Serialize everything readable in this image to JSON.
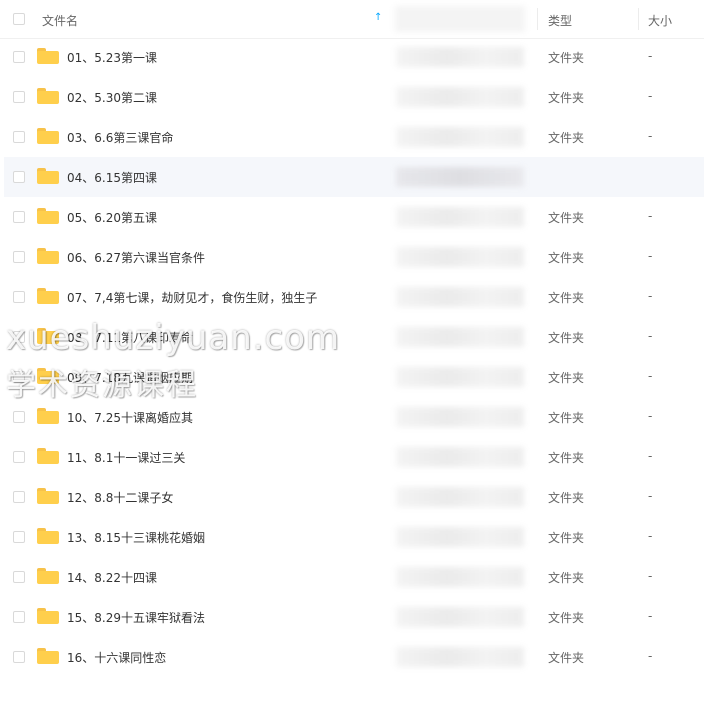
{
  "header": {
    "name_label": "文件名",
    "sort_indicator": "↑",
    "type_label": "类型",
    "size_label": "大小"
  },
  "rows": [
    {
      "name": "01、5.23第一课",
      "type": "文件夹",
      "size": "-"
    },
    {
      "name": "02、5.30第二课",
      "type": "文件夹",
      "size": "-"
    },
    {
      "name": "03、6.6第三课官命",
      "type": "文件夹",
      "size": "-"
    },
    {
      "name": "04、6.15第四课",
      "type": "",
      "size": ""
    },
    {
      "name": "05、6.20第五课",
      "type": "文件夹",
      "size": "-"
    },
    {
      "name": "06、6.27第六课当官条件",
      "type": "文件夹",
      "size": "-"
    },
    {
      "name": "07、7,4第七课，劫财见才，食伤生财，独生子",
      "type": "文件夹",
      "size": "-"
    },
    {
      "name": "08、7.11第八课印寿命",
      "type": "文件夹",
      "size": "-"
    },
    {
      "name": "09、7.18九课婚姻应期",
      "type": "文件夹",
      "size": "-"
    },
    {
      "name": "10、7.25十课离婚应其",
      "type": "文件夹",
      "size": "-"
    },
    {
      "name": "11、8.1十一课过三关",
      "type": "文件夹",
      "size": "-"
    },
    {
      "name": "12、8.8十二课子女",
      "type": "文件夹",
      "size": "-"
    },
    {
      "name": "13、8.15十三课桃花婚姻",
      "type": "文件夹",
      "size": "-"
    },
    {
      "name": "14、8.22十四课",
      "type": "文件夹",
      "size": "-"
    },
    {
      "name": "15、8.29十五课牢狱看法",
      "type": "文件夹",
      "size": "-"
    },
    {
      "name": "16、十六课同性恋",
      "type": "文件夹",
      "size": "-"
    }
  ],
  "watermark": {
    "line1": "xueshuziyuan.com",
    "line2": "学术资源课程"
  },
  "colors": {
    "folder": "#ffcf4c",
    "accent": "#06a7ff",
    "hover_row": "#f5f7fb"
  },
  "icons": {
    "folder": "folder-icon",
    "checkbox": "checkbox"
  }
}
